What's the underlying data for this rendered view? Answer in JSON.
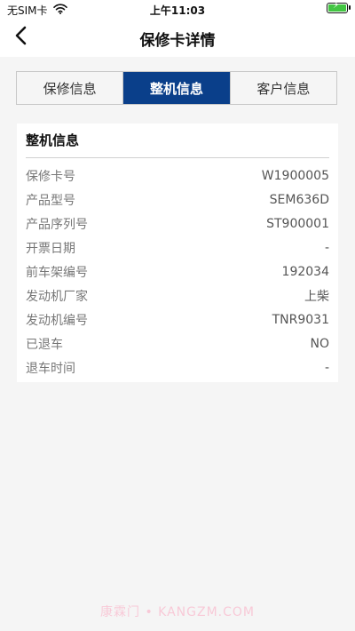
{
  "status_bar": {
    "carrier": "无SIM卡",
    "time": "上午11:03",
    "wifi_icon": "wifi-icon",
    "battery_icon": "battery-charging-icon"
  },
  "nav": {
    "title": "保修卡详情",
    "back_icon": "chevron-left-icon"
  },
  "tabs": [
    {
      "label": "保修信息",
      "active": false
    },
    {
      "label": "整机信息",
      "active": true
    },
    {
      "label": "客户信息",
      "active": false
    }
  ],
  "card": {
    "title": "整机信息",
    "rows": [
      {
        "label": "保修卡号",
        "value": "W1900005"
      },
      {
        "label": "产品型号",
        "value": "SEM636D"
      },
      {
        "label": "产品序列号",
        "value": "ST900001"
      },
      {
        "label": "开票日期",
        "value": "-"
      },
      {
        "label": "前车架编号",
        "value": "192034"
      },
      {
        "label": "发动机厂家",
        "value": "上柴"
      },
      {
        "label": "发动机编号",
        "value": "TNR9031"
      },
      {
        "label": "已退车",
        "value": "NO"
      },
      {
        "label": "退车时间",
        "value": "-"
      }
    ]
  },
  "watermark": "康霖门 • KANGZM.COM",
  "colors": {
    "accent": "#0a3f8a",
    "background": "#f5f5f5",
    "card": "#ffffff"
  }
}
